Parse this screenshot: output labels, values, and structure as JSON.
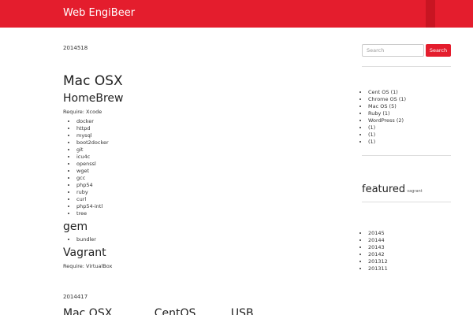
{
  "header": {
    "site_title": "Web EngiBeer"
  },
  "post": {
    "date": "2014518",
    "title": "Mac OSX",
    "sections": {
      "homebrew": {
        "heading": "HomeBrew",
        "require": "Require: Xcode",
        "items": [
          "docker",
          "httpd",
          "mysql",
          "boot2docker",
          "git",
          "icu4c",
          "openssl",
          "wget",
          "gcc",
          "php54",
          "ruby",
          "curl",
          "php54-intl",
          "tree"
        ]
      },
      "gem": {
        "heading": "gem",
        "items": [
          "bundler"
        ]
      },
      "vagrant": {
        "heading": "Vagrant",
        "require": "Require: VirtualBox"
      }
    }
  },
  "next_post": {
    "date": "2014417",
    "title_partial": "Mac OSX&nbsp;&nbsp;&nbsp;&nbsp;&nbsp;&nbsp;&nbsp;&nbsp;&nbsp;&nbsp;&nbsp;&nbsp;CentOS&nbsp;&nbsp;&nbsp;&nbsp;&nbsp;&nbsp;&nbsp;&nbsp;&nbsp;&nbsp;USB"
  },
  "sidebar": {
    "search": {
      "placeholder": "Search",
      "button_label": "Search"
    },
    "categories": [
      "Cent OS (1)",
      "Chrome OS (1)",
      "Mac OS (5)",
      "Ruby (1)",
      "WordPress (2)",
      " (1)",
      " (1)",
      " (1)"
    ],
    "featured": {
      "title": "featured",
      "tag": "vagrant"
    },
    "archives": [
      "20145",
      "20144",
      "20143",
      "20142",
      "201312",
      "201311"
    ]
  },
  "colors": {
    "brand": "#e41d2d",
    "stripe": "#c81522"
  }
}
